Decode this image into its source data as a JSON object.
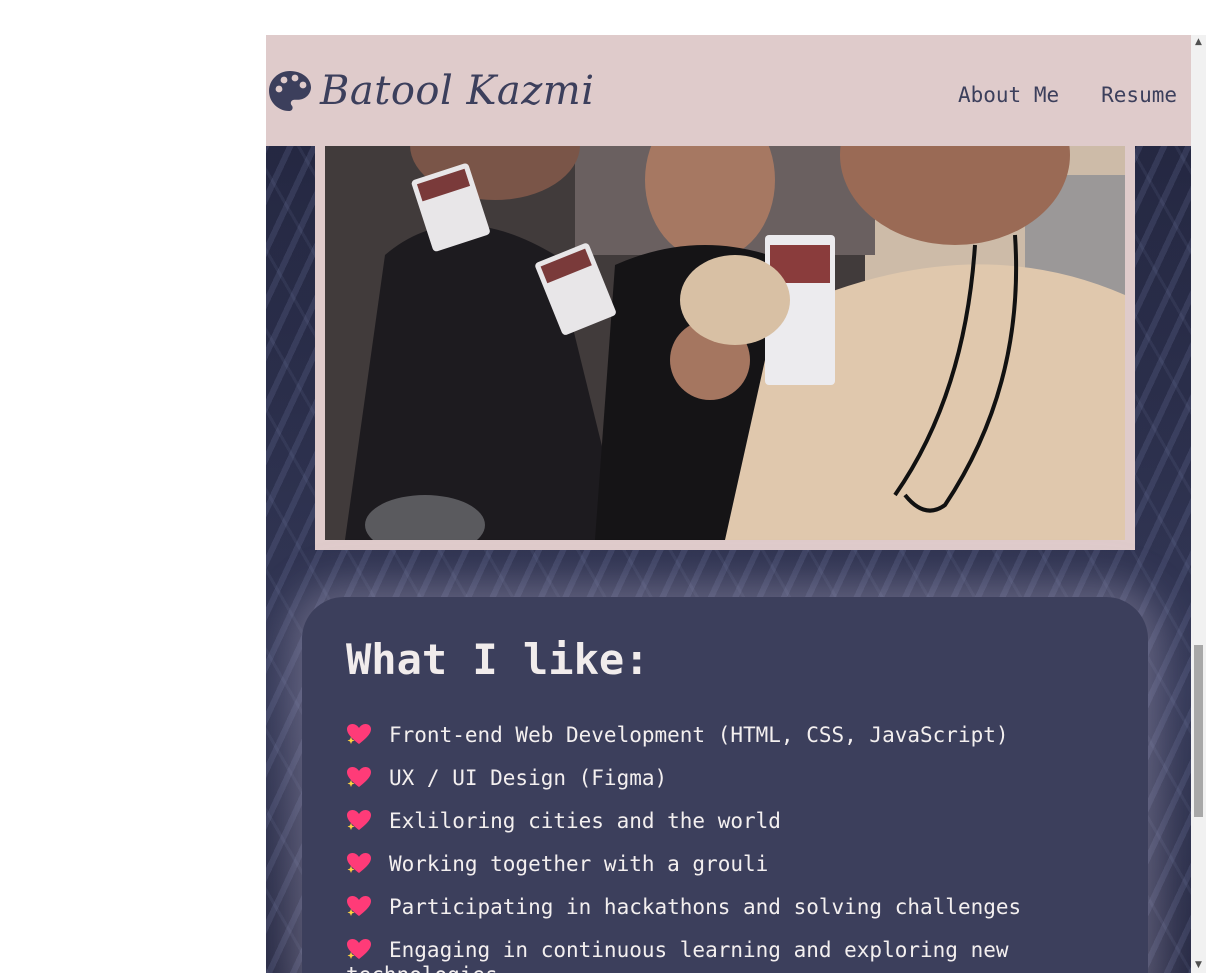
{
  "brand": {
    "name": "Batool Kazmi",
    "icon": "palette-icon"
  },
  "nav": {
    "links": [
      {
        "label": "About Me"
      },
      {
        "label": "Resume"
      }
    ]
  },
  "likes": {
    "title": "What I like:",
    "bullet_icon": "sparkling-heart-icon",
    "items": [
      "Front-end Web Development (HTML, CSS, JavaScript)",
      "UX / UI Design (Figma)",
      "Exliloring cities and the world",
      "Working together with a grouli",
      "Participating in hackathons and solving challenges",
      "Engaging in continuous learning and exploring new technologies"
    ]
  },
  "colors": {
    "navbar_bg": "#dfcbcb",
    "text_dark": "#3c3f5c",
    "card_bg": "#3c3f5c",
    "page_bg": "#2a2d45"
  }
}
